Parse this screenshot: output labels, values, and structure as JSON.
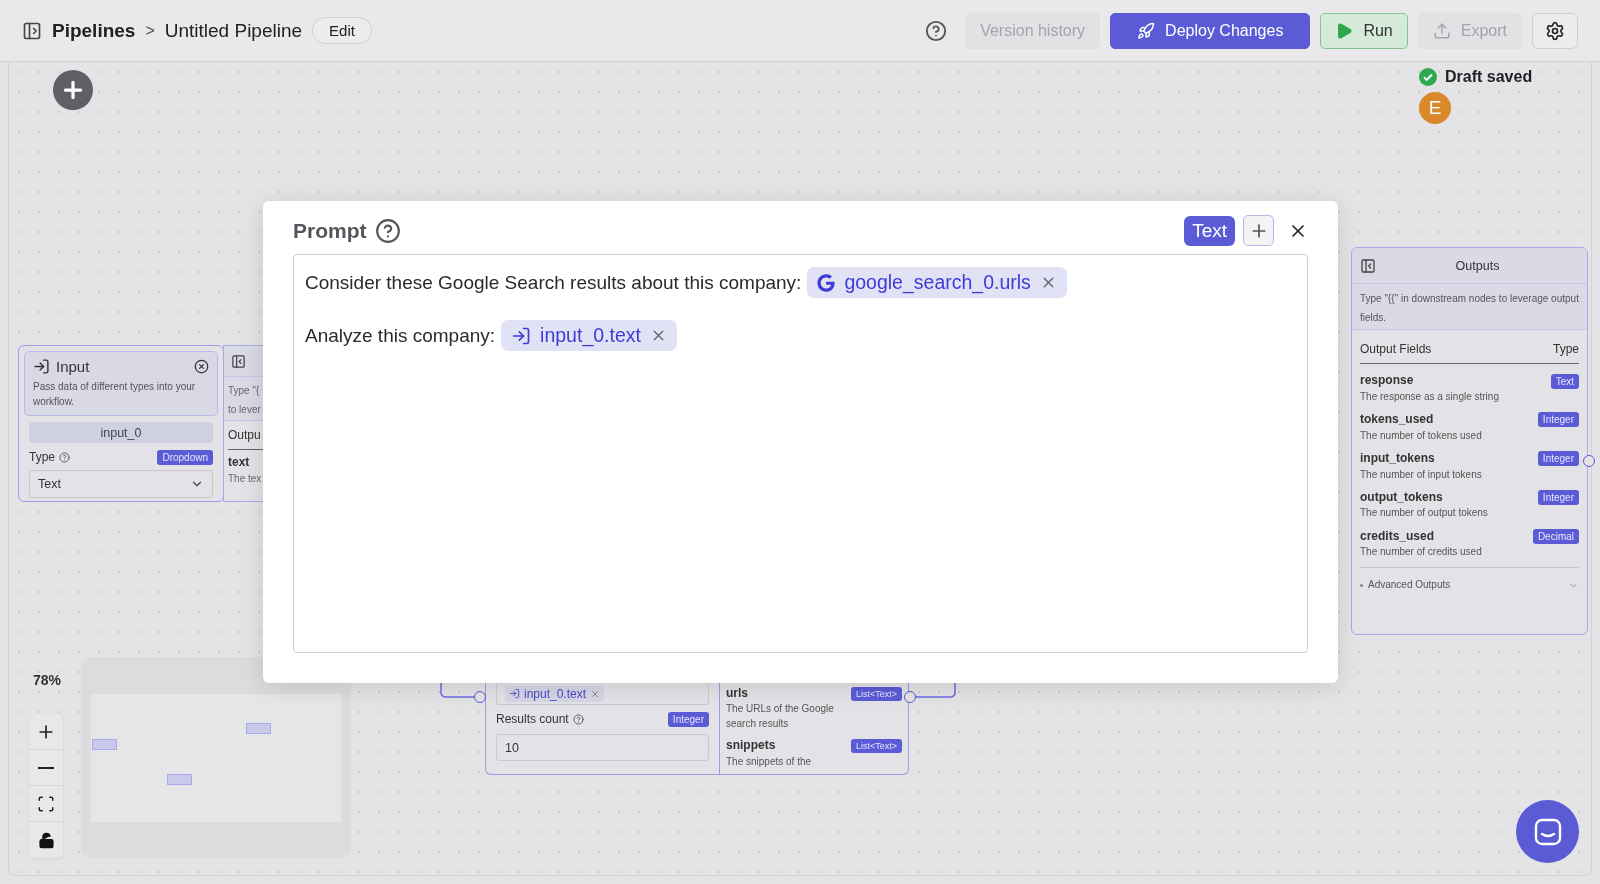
{
  "header": {
    "breadcrumb": [
      "Pipelines",
      "Untitled Pipeline"
    ],
    "separator": ">",
    "edit_label": "Edit",
    "actions": [
      {
        "label": "Version history",
        "kind": "secondary",
        "disabled": true
      },
      {
        "label": "Deploy Changes",
        "kind": "primary",
        "disabled": false
      },
      {
        "label": "Run",
        "kind": "run",
        "disabled": false
      },
      {
        "label": "Export",
        "kind": "secondary",
        "disabled": true
      }
    ]
  },
  "status": {
    "text": "Draft saved",
    "avatar": "E"
  },
  "zoom": {
    "reading": "78%"
  },
  "input_node": {
    "title": "Input",
    "description": "Pass data of different types into your workflow.",
    "name": "input_0",
    "type_label": "Type",
    "type_badge": "Dropdown",
    "type_value": "Text"
  },
  "input_outputs_panel": {
    "lines": [
      "Type \"{",
      "to lever"
    ],
    "heading": "Outpu",
    "field": "text",
    "field_description": "The tex"
  },
  "search_node": {
    "chip": "input_0.text",
    "count_label": "Results count",
    "count_badge": "Integer",
    "count_value": "10",
    "outputs": [
      {
        "name": "urls",
        "type": "List<Text>",
        "description": "The URLs of the Google search results"
      },
      {
        "name": "snippets",
        "type": "List<Text>",
        "description": "The snippets of the"
      }
    ]
  },
  "outputs_panel": {
    "title": "Outputs",
    "hint": "Type \"{{\" in downstream nodes to leverage output fields.",
    "column_1": "Output Fields",
    "column_2": "Type",
    "fields": [
      {
        "name": "response",
        "type": "Text",
        "description": "The response as a single string"
      },
      {
        "name": "tokens_used",
        "type": "Integer",
        "description": "The number of tokens used"
      },
      {
        "name": "input_tokens",
        "type": "Integer",
        "description": "The number of input tokens"
      },
      {
        "name": "output_tokens",
        "type": "Integer",
        "description": "The number of output tokens"
      },
      {
        "name": "credits_used",
        "type": "Decimal",
        "description": "The number of credits used"
      }
    ],
    "advanced": {
      "label": "Advanced Outputs",
      "expanded": false
    }
  },
  "prompt_dialog": {
    "title": "Prompt",
    "mode": "Text",
    "lines": [
      {
        "text": "Consider these Google Search results about this company:",
        "variable": {
          "label": "google_search_0.urls",
          "kind": "google"
        }
      },
      {
        "text": "Analyze this company:",
        "variable": {
          "label": "input_0.text",
          "kind": "input"
        }
      }
    ]
  }
}
